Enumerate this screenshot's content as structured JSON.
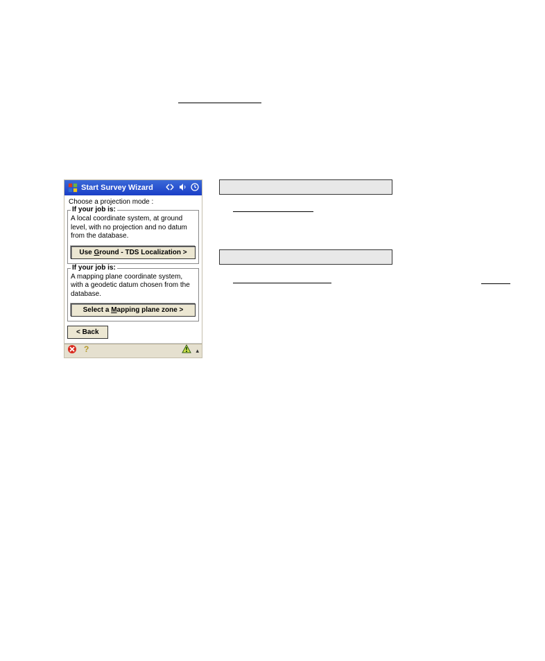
{
  "title_bar": {
    "title": "Start Survey Wizard"
  },
  "prompt": "Choose a projection mode :",
  "group1": {
    "legend": "If your job is:",
    "desc": "A local coordinate system, at ground level, with no projection and no datum from the database.",
    "button_prefix": "Use ",
    "button_ul": "G",
    "button_suffix": "round - TDS Localization >"
  },
  "group2": {
    "legend": "If your job is:",
    "desc": "A mapping plane coordinate system, with a geodetic datum chosen from the database.",
    "button_prefix": "Select a ",
    "button_ul": "M",
    "button_suffix": "apping plane zone >"
  },
  "back_button": "< Back"
}
